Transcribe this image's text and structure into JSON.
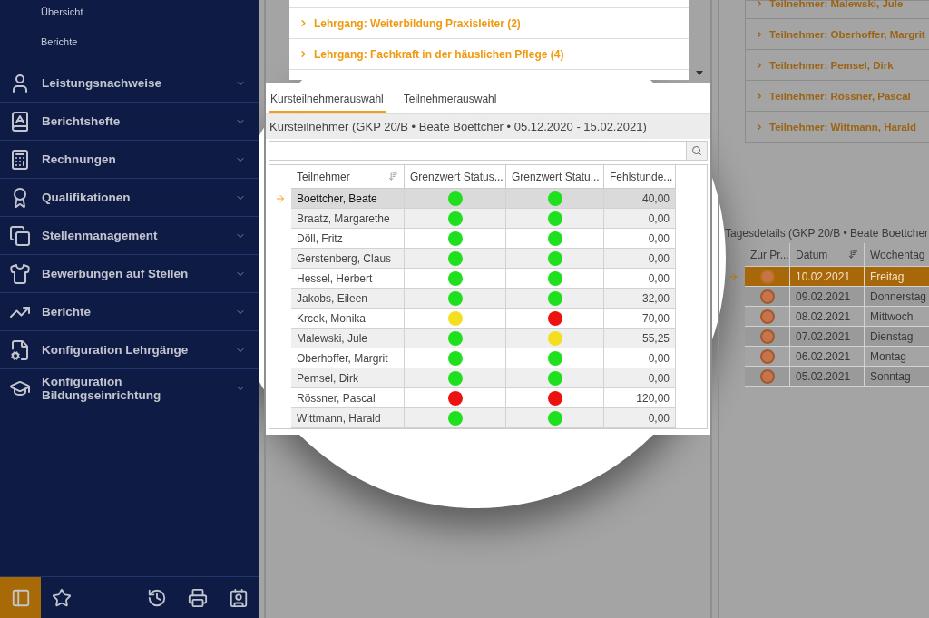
{
  "sidebar": {
    "sub_items": [
      {
        "label": "Übersicht"
      },
      {
        "label": "Berichte"
      }
    ],
    "items": [
      {
        "kind": "desk",
        "label": "Leistungsnachweise"
      },
      {
        "kind": "book",
        "label": "Berichtshefte"
      },
      {
        "kind": "calculator",
        "label": "Rechnungen"
      },
      {
        "kind": "award",
        "label": "Qualifikationen"
      },
      {
        "kind": "copies",
        "label": "Stellenmanagement"
      },
      {
        "kind": "shirt",
        "label": "Bewerbungen auf Stellen"
      },
      {
        "kind": "chart",
        "label": "Berichte"
      },
      {
        "kind": "config",
        "label": "Konfiguration Lehrgänge"
      },
      {
        "kind": "school",
        "label": "Konfiguration Bildungseinrichtung"
      }
    ],
    "footer_buttons": [
      {
        "kind": "panel",
        "selected": true
      },
      {
        "kind": "star",
        "selected": false
      },
      {
        "kind": "history",
        "selected": false
      },
      {
        "kind": "print",
        "selected": false
      },
      {
        "kind": "contact",
        "selected": false
      }
    ]
  },
  "course_groups": [
    {
      "label": "Lehrgang: Weiterbildung Praxisleiter (2)"
    },
    {
      "label": "Lehrgang: Fachkraft in der häuslichen Pflege (4)"
    }
  ],
  "tabs": [
    {
      "label": "Kursteilnehmerauswahl",
      "selected": true
    },
    {
      "label": "Teilnehmerauswahl",
      "selected": false
    }
  ],
  "participants": {
    "caption": "Kursteilnehmer (GKP 20/B • Beate Boettcher • 05.12.2020 - 15.02.2021)",
    "columns": [
      "Teilnehmer",
      "Grenzwert Status...",
      "Grenzwert Statu...",
      "Fehlstunde..."
    ],
    "rows": [
      {
        "name": "Boettcher, Beate",
        "statuses": [
          {
            "color": "#1ee01e"
          },
          {
            "color": "#1ee01e"
          }
        ],
        "hours": "40,00",
        "current": true
      },
      {
        "name": "Braatz, Margarethe",
        "statuses": [
          {
            "color": "#1ee01e"
          },
          {
            "color": "#1ee01e"
          }
        ],
        "hours": "0,00",
        "current": false
      },
      {
        "name": "Döll, Fritz",
        "statuses": [
          {
            "color": "#1ee01e"
          },
          {
            "color": "#1ee01e"
          }
        ],
        "hours": "0,00",
        "current": false
      },
      {
        "name": "Gerstenberg, Claus",
        "statuses": [
          {
            "color": "#1ee01e"
          },
          {
            "color": "#1ee01e"
          }
        ],
        "hours": "0,00",
        "current": false
      },
      {
        "name": "Hessel, Herbert",
        "statuses": [
          {
            "color": "#1ee01e"
          },
          {
            "color": "#1ee01e"
          }
        ],
        "hours": "0,00",
        "current": false
      },
      {
        "name": "Jakobs, Eileen",
        "statuses": [
          {
            "color": "#1ee01e"
          },
          {
            "color": "#1ee01e"
          }
        ],
        "hours": "32,00",
        "current": false
      },
      {
        "name": "Krcek, Monika",
        "statuses": [
          {
            "color": "#f2e020"
          },
          {
            "color": "#ee1111"
          }
        ],
        "hours": "70,00",
        "current": false
      },
      {
        "name": "Malewski, Jule",
        "statuses": [
          {
            "color": "#1ee01e"
          },
          {
            "color": "#f2e020"
          }
        ],
        "hours": "55,25",
        "current": false
      },
      {
        "name": "Oberhoffer, Margrit",
        "statuses": [
          {
            "color": "#1ee01e"
          },
          {
            "color": "#1ee01e"
          }
        ],
        "hours": "0,00",
        "current": false
      },
      {
        "name": "Pemsel, Dirk",
        "statuses": [
          {
            "color": "#1ee01e"
          },
          {
            "color": "#1ee01e"
          }
        ],
        "hours": "0,00",
        "current": false
      },
      {
        "name": "Rössner, Pascal",
        "statuses": [
          {
            "color": "#ee1111"
          },
          {
            "color": "#ee1111"
          }
        ],
        "hours": "120,00",
        "current": false
      },
      {
        "name": "Wittmann, Harald",
        "statuses": [
          {
            "color": "#1ee01e"
          },
          {
            "color": "#1ee01e"
          }
        ],
        "hours": "0,00",
        "current": false
      }
    ]
  },
  "participant_groups": [
    {
      "label": "Teilnehmer: Malewski, Jule"
    },
    {
      "label": "Teilnehmer: Oberhoffer, Margrit"
    },
    {
      "label": "Teilnehmer: Pemsel, Dirk"
    },
    {
      "label": "Teilnehmer: Rössner, Pascal"
    },
    {
      "label": "Teilnehmer: Wittmann, Harald"
    }
  ],
  "day_details": {
    "caption": "Tagesdetails (GKP 20/B • Beate Boettcher",
    "columns": [
      "Zur Pr...",
      "Datum",
      "Wochentag"
    ],
    "rows": [
      {
        "date": "10.02.2021",
        "weekday": "Freitag",
        "selected": true
      },
      {
        "date": "09.02.2021",
        "weekday": "Donnerstag",
        "selected": false
      },
      {
        "date": "08.02.2021",
        "weekday": "Mittwoch",
        "selected": false
      },
      {
        "date": "07.02.2021",
        "weekday": "Dienstag",
        "selected": false
      },
      {
        "date": "06.02.2021",
        "weekday": "Montag",
        "selected": false
      },
      {
        "date": "05.02.2021",
        "weekday": "Sonntag",
        "selected": false
      }
    ]
  }
}
